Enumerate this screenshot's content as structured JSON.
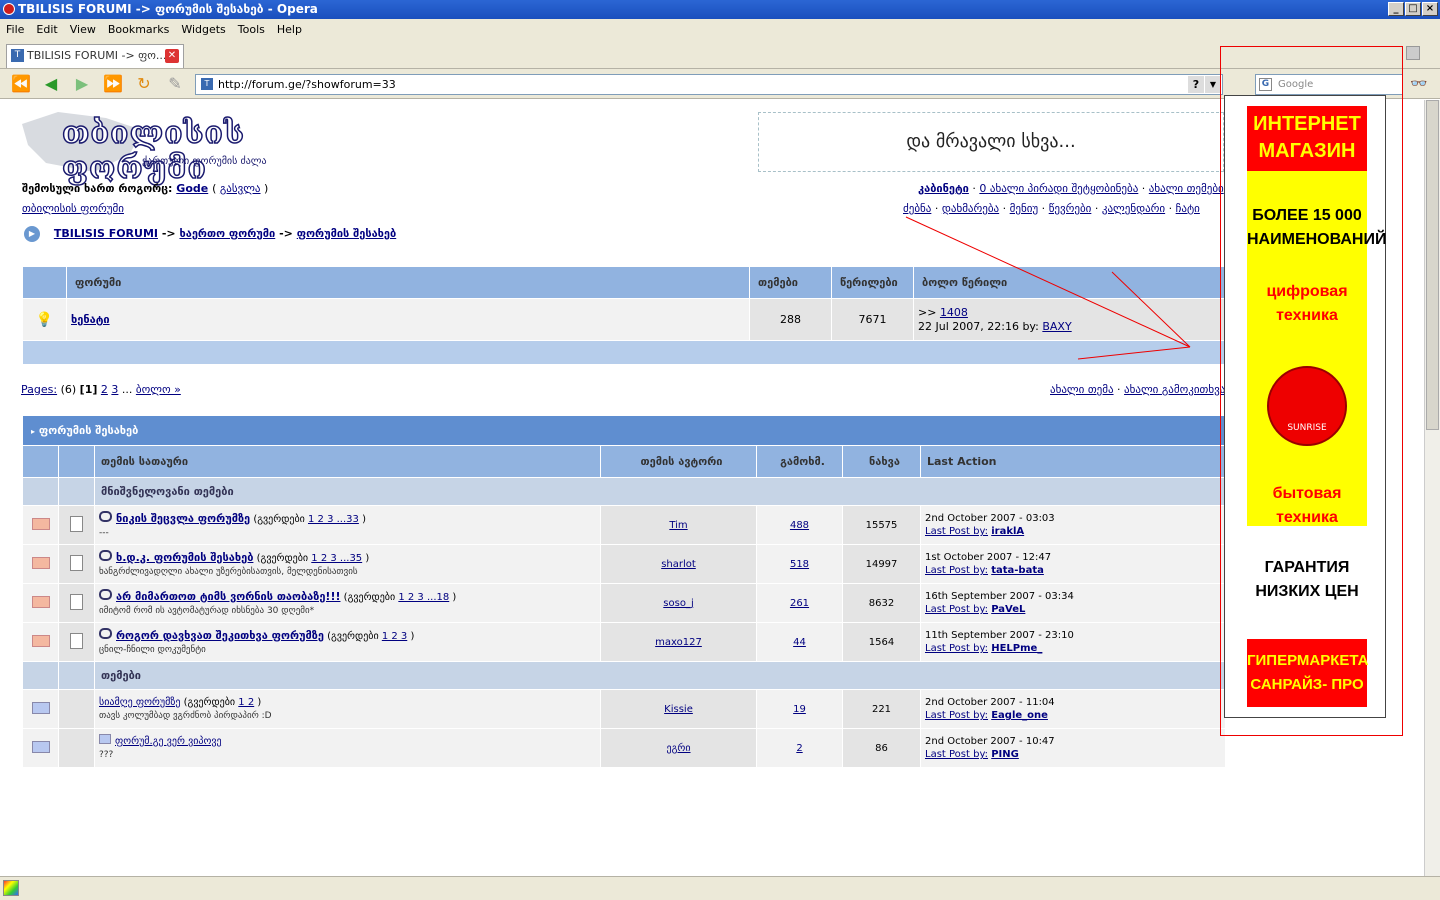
{
  "window": {
    "title": "TBILISIS FORUMI -> ფორუმის შესახებ - Opera"
  },
  "menu": [
    "File",
    "Edit",
    "View",
    "Bookmarks",
    "Widgets",
    "Tools",
    "Help"
  ],
  "tab": {
    "label": "TBILISIS FORUMI -> ფო..."
  },
  "address": {
    "url": "http://forum.ge/?showforum=33"
  },
  "search": {
    "placeholder": "Google"
  },
  "header": {
    "logo_name": "თბილისის ფორუმი",
    "logo_sub": "ქართული ფორუმის ძალა",
    "banner": "და მრავალი სხვა..."
  },
  "user": {
    "welcome": "შემოსული ხართ როგორც:",
    "name": "Gode",
    "logout": "გასვლა",
    "forum_link": "თბილისის ფორუმი"
  },
  "toplinks1": {
    "cabinet": "კაბინეტი",
    "pm": "0 ახალი პირადი შეტყობინება",
    "new_topics": "ახალი თემები"
  },
  "toplinks2": [
    "ძებნა",
    "დახმარება",
    "მენიუ",
    "წევრები",
    "კალენდარი",
    "ჩატი"
  ],
  "breadcrumb": {
    "root": "TBILISIS FORUMI",
    "sep": "->",
    "l2": "ხაერთო ფორუმი",
    "l3": "ფორუმის შესახებ"
  },
  "forum_table": {
    "headers": [
      "ფორუმი",
      "თემები",
      "წერილები",
      "ბოლო წერილი"
    ],
    "row": {
      "name": "ხენატი",
      "topics": "288",
      "posts": "7671",
      "last_id": "1408",
      "last_prefix": ">>",
      "last_date": "22 Jul 2007, 22:16 by:",
      "last_user": "BAXY"
    }
  },
  "pager": {
    "label": "Pages:",
    "count": "(6)",
    "current": "[1]",
    "p2": "2",
    "p3": "3",
    "more": "...",
    "next": "ბოლო »"
  },
  "new_links": {
    "new_topic": "ახალი თემა",
    "new_poll": "ახალი გამოკითხვა"
  },
  "topics": {
    "title": "ფორუმის შესახებ",
    "headers": [
      "თემის სათაური",
      "თემის ავტორი",
      "გამოხმ.",
      "ნახვა",
      "Last Action"
    ],
    "section_important": "მნიშვნელოვანი თემები",
    "section_topics": "თემები",
    "rows": [
      {
        "title": "ნიკის შეცვლა ფორუმზე",
        "pages_label": "(გვერდები",
        "pages": "1 2 3 ...33",
        "close": ")",
        "desc": "---",
        "author": "Tim",
        "replies": "488",
        "views": "15575",
        "date": "2nd October 2007 - 03:03",
        "lp_label": "Last Post by:",
        "lp_user": "iraklA"
      },
      {
        "title": "ხ.დ.კ. ფორუმის შესახებ",
        "pages_label": "(გვერდები",
        "pages": "1 2 3 ...35",
        "close": ")",
        "desc": "ხანგრძლივადღლი ახალი უზერებისათვის, მელდენისათვის",
        "author": "sharlot",
        "replies": "518",
        "views": "14997",
        "date": "1st October 2007 - 12:47",
        "lp_label": "Last Post by:",
        "lp_user": "tata-bata"
      },
      {
        "title": "არ მიმართოთ ტიმს ვორნის თაობაზე!!!",
        "pages_label": "(გვერდები",
        "pages": "1 2 3 ...18",
        "close": ")",
        "desc": "იმიტომ რომ ის ავტომატურად იხსნება 30 დღემი*",
        "author": "soso_j",
        "replies": "261",
        "views": "8632",
        "date": "16th September 2007 - 03:34",
        "lp_label": "Last Post by:",
        "lp_user": "PaVeL"
      },
      {
        "title": "როგორ დავხვათ შეკითხვა ფორუმზე",
        "pages_label": "(გვერდები",
        "pages": "1 2 3",
        "close": ")",
        "desc": "ცნილ-ჩნილი დოკუმენტი",
        "author": "maxo127",
        "replies": "44",
        "views": "1564",
        "date": "11th September 2007 - 23:10",
        "lp_label": "Last Post by:",
        "lp_user": "HELPme_"
      },
      {
        "title": "სიამღე ფორუმზე",
        "pages_label": "(გვერდები",
        "pages": "1 2",
        "close": ")",
        "desc": "თავს კოლუმბად ვგრძნობ პირდაპირ :D",
        "author": "Kissie",
        "replies": "19",
        "views": "221",
        "date": "2nd October 2007 - 11:04",
        "lp_label": "Last Post by:",
        "lp_user": "Eagle_one"
      },
      {
        "title": "ფორუმ.გე ვერ ვიპოვე",
        "pages_label": "",
        "pages": "",
        "close": "",
        "desc": "???",
        "author": "ეგრი",
        "replies": "2",
        "views": "86",
        "date": "2nd October 2007 - 10:47",
        "lp_label": "Last Post by:",
        "lp_user": "PING"
      }
    ]
  },
  "ad": {
    "top": "ИНТЕРНЕТ МАГАЗИН",
    "line1": "БОЛЕЕ 15 000 НАИМЕНОВАНИЙ",
    "line2": "цифровая техника",
    "brand": "SUNRISE",
    "line3": "бытовая техника",
    "line4": "ГАРАНТИЯ НИЗКИХ ЦЕН",
    "bottom": "ГИПЕРМАРКЕТА САНРАЙЗ- ПРО",
    "colors": {
      "yellow": "#ffff00",
      "red": "#ff0000"
    }
  }
}
